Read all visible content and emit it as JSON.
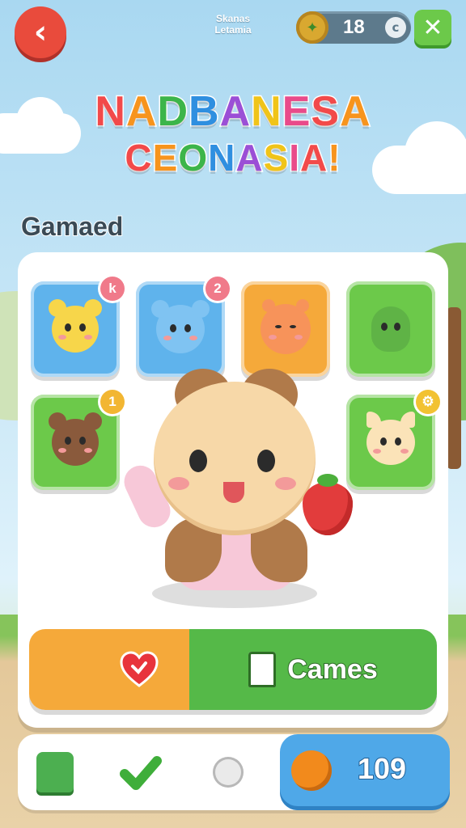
{
  "header": {
    "back_label": "‹",
    "caption_line1": "Skanas",
    "caption_line2": "Letamia",
    "stat_value": "18",
    "stat_coin_symbol": "c",
    "close_label": "✕"
  },
  "title": {
    "line1": "NADBANESA",
    "line2": "CEONASIA!",
    "letter_colors": [
      "#f24a4a",
      "#f7941d",
      "#3cb54a",
      "#2f8fe0",
      "#9b4fd6",
      "#f0c419",
      "#e94b8a"
    ]
  },
  "section": {
    "label": "Gamaed"
  },
  "tiles": [
    {
      "name": "yellow-bear",
      "bg": "#5fb3ec",
      "badge": "k",
      "badge_color": "#f07a8a"
    },
    {
      "name": "blue-mouse",
      "bg": "#5fb3ec",
      "badge": "2",
      "badge_color": "#f07a8a"
    },
    {
      "name": "orange-blob",
      "bg": "#f5a93a",
      "badge": "",
      "badge_color": ""
    },
    {
      "name": "green-dino",
      "bg": "#6cc94a",
      "badge": "",
      "badge_color": ""
    },
    {
      "name": "brown-bear",
      "bg": "#6cc94a",
      "badge": "1",
      "badge_color": "#f2b632"
    },
    {
      "name": "cream-cat",
      "bg": "#6cc94a",
      "badge": "⚙",
      "badge_color": "#f2c232"
    }
  ],
  "actions": {
    "favorite_icon": "heart-icon",
    "games_label": "Cames"
  },
  "bottom_nav": {
    "items": [
      "puzzle-icon",
      "check-icon",
      "timer-icon"
    ],
    "coin_value": "109"
  },
  "colors": {
    "accent_red": "#e94b3c",
    "accent_green": "#55b948",
    "accent_orange": "#f5a93a",
    "accent_blue": "#4fa8e8"
  }
}
